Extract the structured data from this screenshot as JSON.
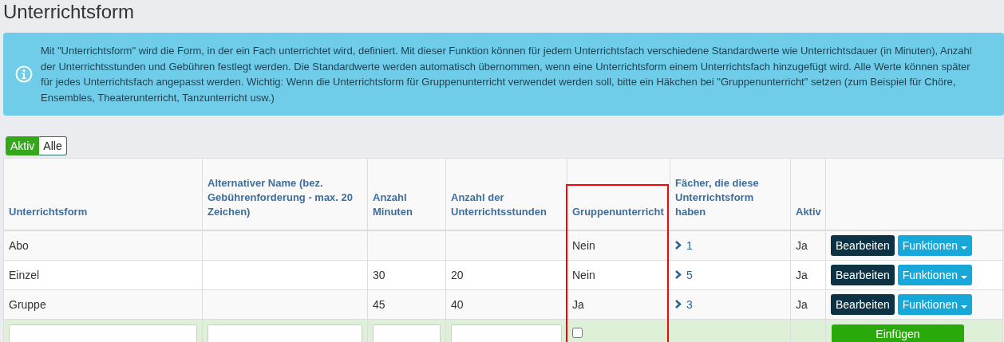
{
  "title": "Unterrichtsform",
  "info": "Mit \"Unterrichtsform\" wird die Form, in der ein Fach unterrichtet wird, definiert. Mit dieser Funktion können für jedem Unterrichtsfach verschiedene Standardwerte wie Unterrichtsdauer (in Minuten), Anzahl der Unterrichtsstunden und Gebühren festlegt werden. Die Standardwerte werden automatisch übernommen, wenn eine Unterrichtsform einem Unterrichtsfach hinzugefügt wird. Alle Werte können später für jedes Unterrichtsfach angepasst werden. Wichtig: Wenn die Unterrichtsform für Gruppenunterricht verwendet werden soll, bitte ein Häkchen bei \"Gruppenunterricht\" setzen (zum Beispiel für Chöre, Ensembles, Theaterunterricht, Tanzunterricht usw.)",
  "filter": [
    {
      "label": "Aktiv",
      "selected": true
    },
    {
      "label": "Alle",
      "selected": false
    }
  ],
  "table": {
    "columns": [
      {
        "label": "Unterrichtsform",
        "highlighted": false
      },
      {
        "label": "Alternativer Name (bez. Gebührenforderung - max. 20 Zeichen)",
        "highlighted": false
      },
      {
        "label": "Anzahl Minuten",
        "highlighted": false
      },
      {
        "label": "Anzahl der Unterrichtsstunden",
        "highlighted": false
      },
      {
        "label": "Gruppenunterricht",
        "highlighted": true
      },
      {
        "label": "Fächer, die diese Unterrichtsform haben",
        "highlighted": false
      },
      {
        "label": "Aktiv",
        "highlighted": false
      }
    ],
    "rows": [
      {
        "name": "Abo",
        "alt_name": "",
        "minutes": "",
        "lessons": "",
        "group": "Nein",
        "subjects": "1",
        "active": "Ja",
        "edit": "Bearbeiten",
        "functions": "Funktionen"
      },
      {
        "name": "Einzel",
        "alt_name": "",
        "minutes": "30",
        "lessons": "20",
        "group": "Nein",
        "subjects": "5",
        "active": "Ja",
        "edit": "Bearbeiten",
        "functions": "Funktionen"
      },
      {
        "name": "Gruppe",
        "alt_name": "",
        "minutes": "45",
        "lessons": "40",
        "group": "Ja",
        "subjects": "3",
        "active": "Ja",
        "edit": "Bearbeiten",
        "functions": "Funktionen"
      }
    ],
    "new_row": {
      "group_checked": false,
      "button": "Einfügen"
    }
  }
}
